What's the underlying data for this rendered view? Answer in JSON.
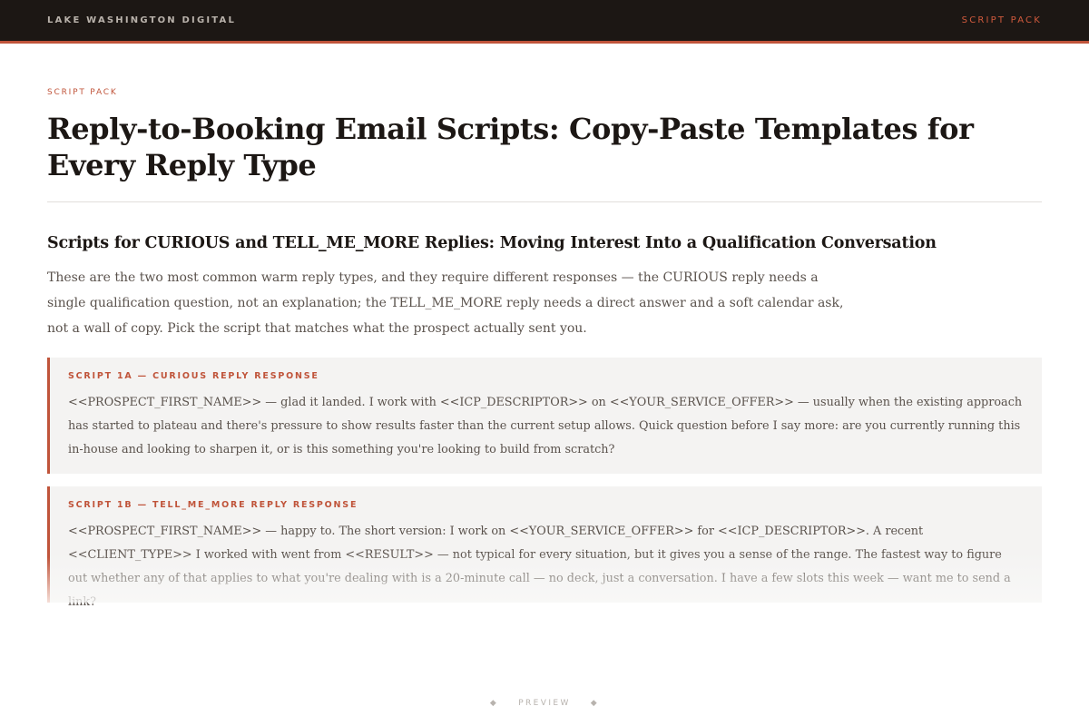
{
  "header": {
    "brand": "LAKE WASHINGTON DIGITAL",
    "nav_link": "SCRIPT PACK"
  },
  "page": {
    "eyebrow": "SCRIPT PACK",
    "title": "Reply-to-Booking Email Scripts: Copy-Paste Templates for Every Reply Type"
  },
  "section": {
    "heading": "Scripts for CURIOUS and TELL_ME_MORE Replies: Moving Interest Into a Qualification Conversation",
    "intro": "These are the two most common warm reply types, and they require different responses — the CURIOUS reply needs a single qualification question, not an explanation; the TELL_ME_MORE reply needs a direct answer and a soft calendar ask, not a wall of copy. Pick the script that matches what the prospect actually sent you."
  },
  "scripts": [
    {
      "label": "SCRIPT 1A — CURIOUS REPLY RESPONSE",
      "body": "<<PROSPECT_FIRST_NAME>> — glad it landed. I work with <<ICP_DESCRIPTOR>> on <<YOUR_SERVICE_OFFER>> — usually when the existing approach has started to plateau and there's pressure to show results faster than the current setup allows. Quick question before I say more: are you currently running this in-house and looking to sharpen it, or is this something you're looking to build from scratch?"
    },
    {
      "label": "SCRIPT 1B — TELL_ME_MORE REPLY RESPONSE",
      "body": "<<PROSPECT_FIRST_NAME>> — happy to. The short version: I work on <<YOUR_SERVICE_OFFER>> for <<ICP_DESCRIPTOR>>. A recent <<CLIENT_TYPE>> I worked with went from <<RESULT>> — not typical for every situation, but it gives you a sense of the range. The fastest way to figure out whether any of that applies to what you're dealing with is a 20-minute call — no deck, just a conversation. I have a few slots this week — want me to send a link?"
    }
  ],
  "footer": {
    "label": "PREVIEW",
    "ornament": "◆"
  },
  "colors": {
    "accent": "#c0543a",
    "header_bg": "#1c1714",
    "card_bg": "#f4f3f2"
  }
}
